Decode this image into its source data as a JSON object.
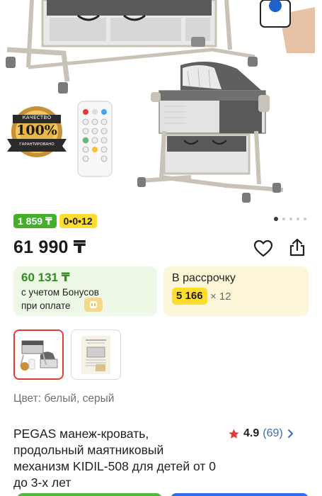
{
  "product_image": {
    "badge_line1": "КАЧЕСТВО",
    "badge_line2": "100%",
    "badge_line3": "ГАРАНТИРОВАНО",
    "carousel_active_index": 0,
    "carousel_total": 5
  },
  "tags": {
    "installment_price": "1 859 ₸",
    "installment_plan": "0•0•12"
  },
  "price": "61 990 ₸",
  "bonus_card": {
    "price": "60 131 ₸",
    "line1": "с учетом Бонусов",
    "line2": "при оплате"
  },
  "installment_card": {
    "title": "В рассрочку",
    "amount": "5 166",
    "multiplier": "× 12"
  },
  "color_line": "Цвет: белый, серый",
  "title": "PEGAS манеж-кровать, продольный маятниковый механизм KIDIL-508 для детей от 0 до 3-х лет",
  "rating": {
    "value": "4.9",
    "count": "(69)"
  },
  "colors": {
    "green_tag": "#43b02a",
    "yellow_tag": "#ffdd2d",
    "bonus_green": "#2f8e1e",
    "link_blue": "#3a6bc4",
    "star_red": "#e53935"
  }
}
